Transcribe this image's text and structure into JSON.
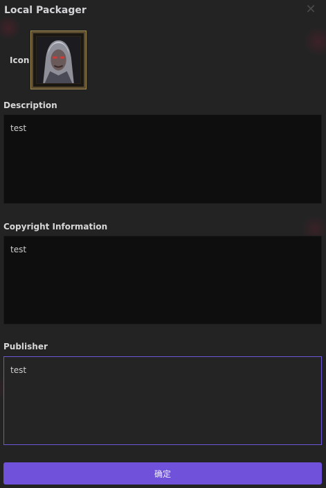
{
  "dialog": {
    "title": "Local Packager",
    "close_icon": "close-icon"
  },
  "icon_section": {
    "label": "Icon",
    "image": "character-portrait-icon"
  },
  "description": {
    "label": "Description",
    "value": "test"
  },
  "copyright": {
    "label": "Copyright Information",
    "value": "test"
  },
  "publisher": {
    "label": "Publisher",
    "value": "test"
  },
  "confirm_button": {
    "label": "确定",
    "color": "#6f52d9"
  },
  "colors": {
    "background": "#232323",
    "field_background": "#0e0e0f",
    "focus_border": "#6b57d8"
  }
}
